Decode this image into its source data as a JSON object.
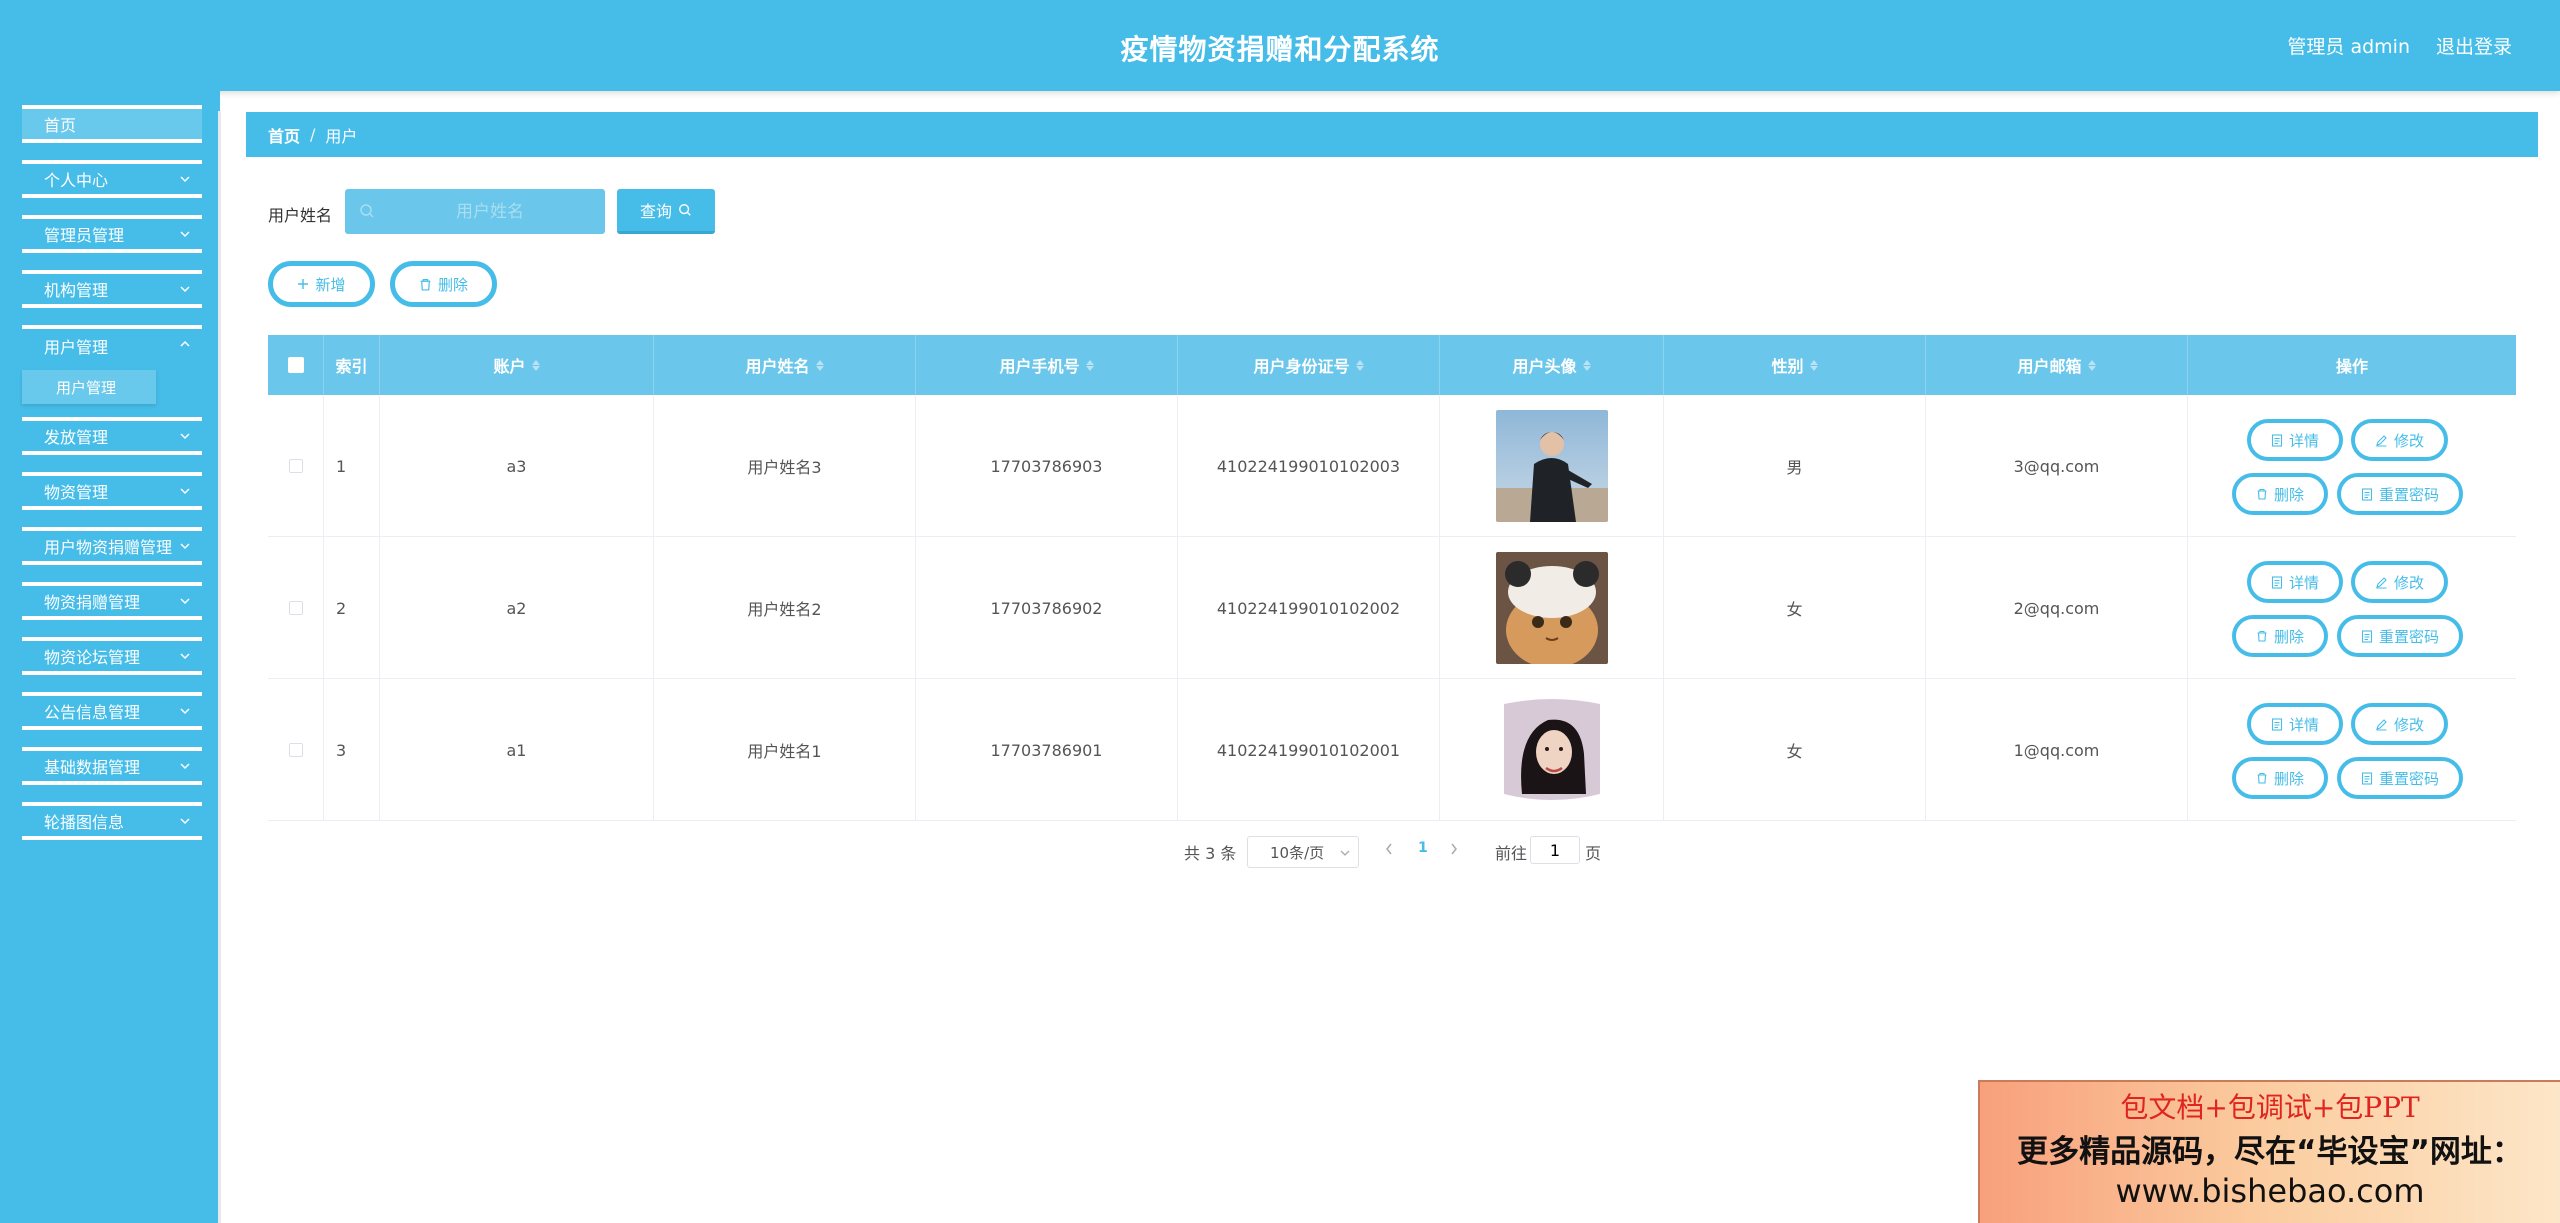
{
  "header": {
    "title": "疫情物资捐赠和分配系统",
    "user": "管理员 admin",
    "logout": "退出登录"
  },
  "sidebar": {
    "items": [
      {
        "label": "首页"
      },
      {
        "label": "个人中心"
      },
      {
        "label": "管理员管理"
      },
      {
        "label": "机构管理"
      },
      {
        "label": "用户管理",
        "sub": "用户管理"
      },
      {
        "label": "发放管理"
      },
      {
        "label": "物资管理"
      },
      {
        "label": "用户物资捐赠管理"
      },
      {
        "label": "物资捐赠管理"
      },
      {
        "label": "物资论坛管理"
      },
      {
        "label": "公告信息管理"
      },
      {
        "label": "基础数据管理"
      },
      {
        "label": "轮播图信息"
      }
    ]
  },
  "breadcrumb": {
    "home": "首页",
    "separator": "/",
    "current": "用户"
  },
  "search": {
    "label": "用户姓名",
    "placeholder": "用户姓名",
    "button": "查询"
  },
  "actions": {
    "add": "新增",
    "delete": "删除"
  },
  "table": {
    "columns": [
      "索引",
      "账户",
      "用户姓名",
      "用户手机号",
      "用户身份证号",
      "用户头像",
      "性别",
      "用户邮箱",
      "操作"
    ],
    "rows": [
      {
        "index": "1",
        "account": "a3",
        "name": "用户姓名3",
        "phone": "17703786903",
        "idcard": "410224199010102003",
        "avatar": "photo-man-jacket",
        "gender": "男",
        "email": "3@qq.com"
      },
      {
        "index": "2",
        "account": "a2",
        "name": "用户姓名2",
        "phone": "17703786902",
        "idcard": "410224199010102002",
        "avatar": "photo-cat-hat",
        "gender": "女",
        "email": "2@qq.com"
      },
      {
        "index": "3",
        "account": "a1",
        "name": "用户姓名1",
        "phone": "17703786901",
        "idcard": "410224199010102001",
        "avatar": "photo-woman-pillow",
        "gender": "女",
        "email": "1@qq.com"
      }
    ],
    "row_actions": {
      "detail": "详情",
      "edit": "修改",
      "delete": "删除",
      "reset": "重置密码"
    }
  },
  "pagination": {
    "total": "共 3 条",
    "page_size": "10条/页",
    "current_page": "1",
    "goto_prefix": "前往",
    "goto_value": "1",
    "goto_suffix": "页"
  },
  "ad": {
    "line1": "包文档+包调试+包PPT",
    "line2": "更多精品源码，尽在“毕设宝”网址：",
    "line3": "www.bishebao.com"
  },
  "colors": {
    "primary": "#46bde8",
    "header_cell": "#6ac6ea"
  }
}
